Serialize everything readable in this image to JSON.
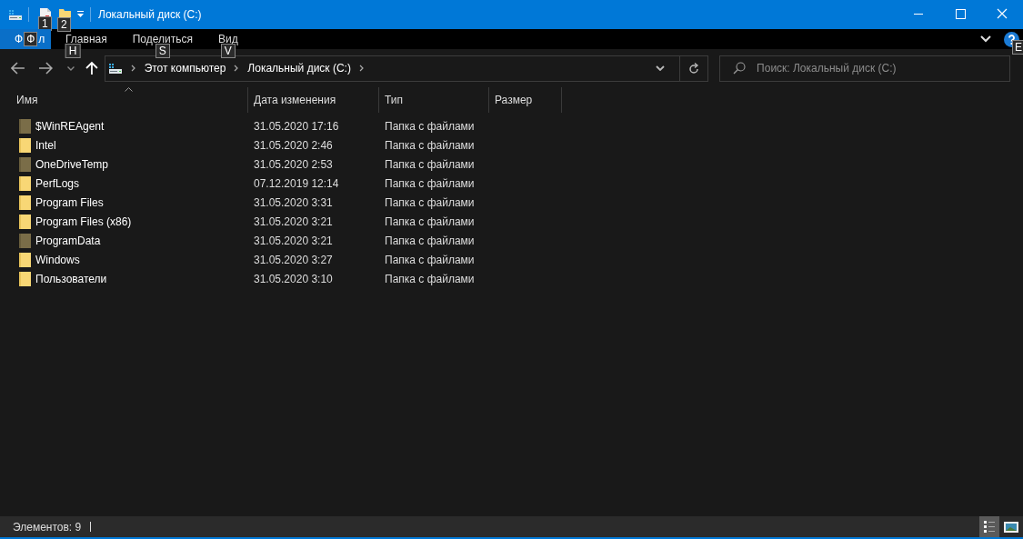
{
  "window": {
    "title": "Локальный диск (C:)"
  },
  "quick_access": {
    "keytips": [
      "1",
      "2"
    ]
  },
  "ribbon": {
    "tabs": [
      {
        "kind": "file",
        "label_start": "Ф",
        "keytip": "Ф",
        "label_end": "л",
        "selected": true
      },
      {
        "kind": "tab",
        "label": "Главная",
        "keytip": "H",
        "selected": false
      },
      {
        "kind": "tab",
        "label": "Поделиться",
        "keytip": "S",
        "selected": false
      },
      {
        "kind": "tab",
        "label": "Вид",
        "keytip": "V",
        "selected": false
      }
    ],
    "help_keytip": "E"
  },
  "address": {
    "crumbs": [
      "Этот компьютер",
      "Локальный диск (C:)"
    ]
  },
  "search": {
    "placeholder": "Поиск: Локальный диск (C:)"
  },
  "table": {
    "columns": [
      {
        "label": "Имя",
        "sorted": true
      },
      {
        "label": "Дата изменения",
        "sorted": false
      },
      {
        "label": "Тип",
        "sorted": false
      },
      {
        "label": "Размер",
        "sorted": false
      }
    ],
    "rows": [
      {
        "name": "$WinREAgent",
        "date": "31.05.2020 17:16",
        "type": "Папка с файлами",
        "hidden": true
      },
      {
        "name": "Intel",
        "date": "31.05.2020 2:46",
        "type": "Папка с файлами",
        "hidden": false
      },
      {
        "name": "OneDriveTemp",
        "date": "31.05.2020 2:53",
        "type": "Папка с файлами",
        "hidden": true
      },
      {
        "name": "PerfLogs",
        "date": "07.12.2019 12:14",
        "type": "Папка с файлами",
        "hidden": false
      },
      {
        "name": "Program Files",
        "date": "31.05.2020 3:31",
        "type": "Папка с файлами",
        "hidden": false
      },
      {
        "name": "Program Files (x86)",
        "date": "31.05.2020 3:21",
        "type": "Папка с файлами",
        "hidden": false
      },
      {
        "name": "ProgramData",
        "date": "31.05.2020 3:21",
        "type": "Папка с файлами",
        "hidden": true
      },
      {
        "name": "Windows",
        "date": "31.05.2020 3:27",
        "type": "Папка с файлами",
        "hidden": false
      },
      {
        "name": "Пользователи",
        "date": "31.05.2020 3:10",
        "type": "Папка с файлами",
        "hidden": false
      }
    ]
  },
  "status_bar": {
    "text": "Элементов: 9",
    "views": [
      {
        "kind": "details",
        "selected": true
      },
      {
        "kind": "tiles",
        "selected": false
      }
    ]
  }
}
